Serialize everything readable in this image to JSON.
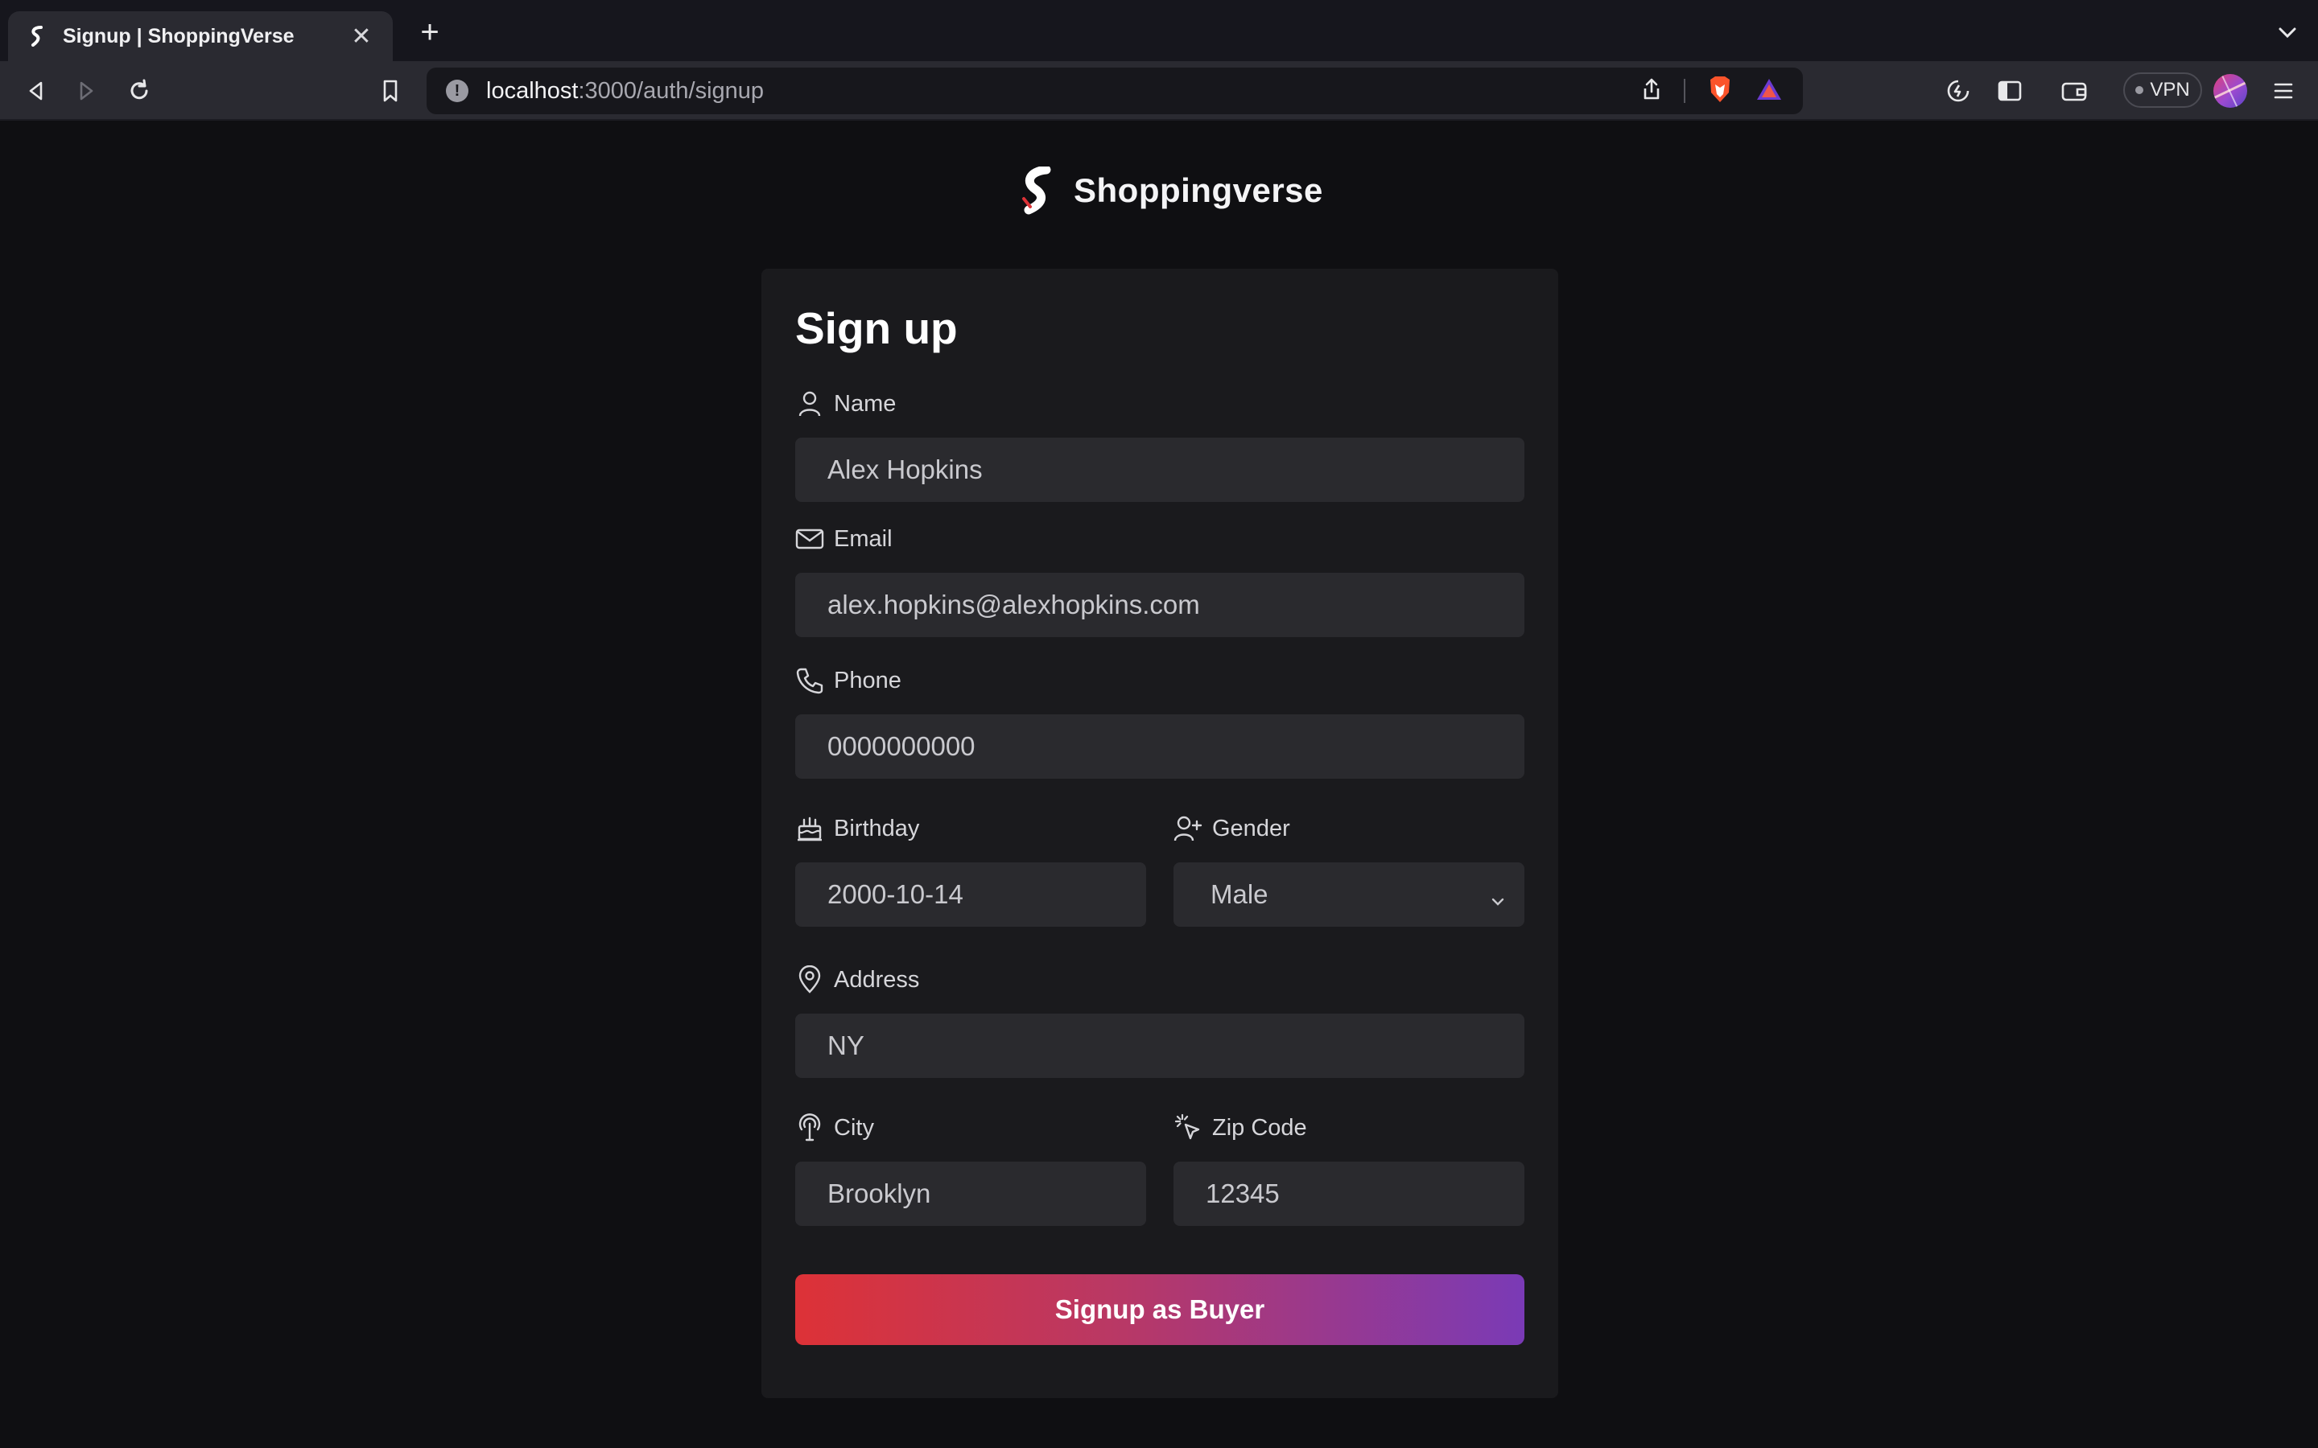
{
  "browser": {
    "tab_title": "Signup | ShoppingVerse",
    "url_host": "localhost",
    "url_path": ":3000/auth/signup",
    "vpn_label": "VPN"
  },
  "page": {
    "brand_name": "Shoppingverse",
    "form_title": "Sign up",
    "fields": {
      "name": {
        "label": "Name",
        "value": "Alex Hopkins"
      },
      "email": {
        "label": "Email",
        "value": "alex.hopkins@alexhopkins.com"
      },
      "phone": {
        "label": "Phone",
        "value": "0000000000"
      },
      "birthday": {
        "label": "Birthday",
        "value": "2000-10-14"
      },
      "gender": {
        "label": "Gender",
        "value": "Male"
      },
      "address": {
        "label": "Address",
        "value": "NY"
      },
      "city": {
        "label": "City",
        "value": "Brooklyn"
      },
      "zip": {
        "label": "Zip Code",
        "value": "12345"
      }
    },
    "submit_label": "Signup as Buyer"
  },
  "colors": {
    "page_bg": "#0f0f12",
    "card_bg": "#1a1a1d",
    "input_bg": "#2a2a2e",
    "button_gradient_start": "#dd3237",
    "button_gradient_end": "#7a3ab6"
  }
}
